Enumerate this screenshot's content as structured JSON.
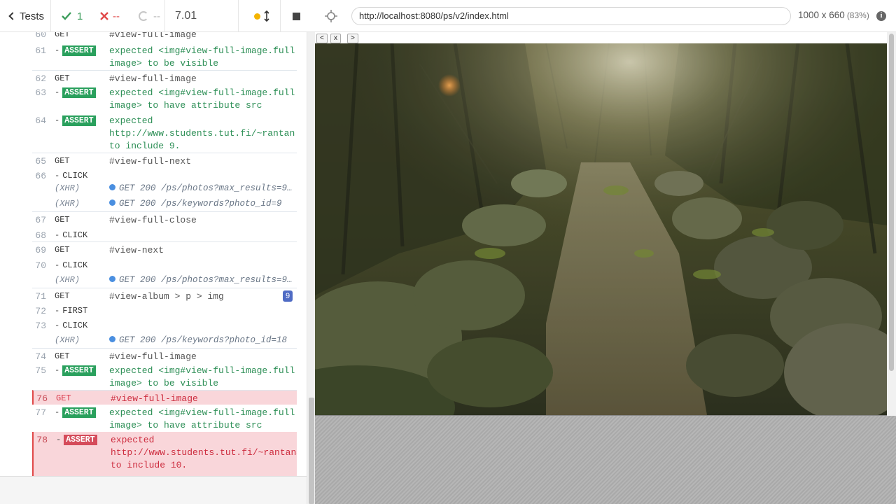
{
  "header": {
    "tests_label": "Tests",
    "passed": "1",
    "failed": "--",
    "pending": "--",
    "duration": "7.01"
  },
  "commands": [
    {
      "num": "60",
      "method": "GET",
      "msg": "#view-full-image",
      "kind": "plain"
    },
    {
      "num": "61",
      "method": "ASSERT",
      "lines": [
        "expected <img#view-full-image.full-",
        "image> to be visible"
      ],
      "kind": "assert"
    },
    {
      "num": "62",
      "method": "GET",
      "msg": "#view-full-image",
      "kind": "plain"
    },
    {
      "num": "63",
      "method": "ASSERT",
      "lines": [
        "expected <img#view-full-image.full-",
        "image> to have attribute src"
      ],
      "kind": "assert"
    },
    {
      "num": "64",
      "method": "ASSERT",
      "lines": [
        "expected",
        " http://www.students.tut.fi/~rantan4...",
        " to include 9."
      ],
      "kind": "assert"
    },
    {
      "num": "65",
      "method": "GET",
      "msg": "#view-full-next",
      "kind": "plain"
    },
    {
      "num": "66",
      "method": "CLICK",
      "kind": "child"
    },
    {
      "num": "",
      "method": "(XHR)",
      "msg": "GET 200 /ps/photos?max_results=9&...",
      "kind": "xhr"
    },
    {
      "num": "",
      "method": "(XHR)",
      "msg": "GET 200 /ps/keywords?photo_id=9",
      "kind": "xhr"
    },
    {
      "num": "67",
      "method": "GET",
      "msg": "#view-full-close",
      "kind": "plain"
    },
    {
      "num": "68",
      "method": "CLICK",
      "kind": "child"
    },
    {
      "num": "69",
      "method": "GET",
      "msg": "#view-next",
      "kind": "plain"
    },
    {
      "num": "70",
      "method": "CLICK",
      "kind": "child"
    },
    {
      "num": "",
      "method": "(XHR)",
      "msg": "GET 200 /ps/photos?max_results=9&...",
      "kind": "xhr"
    },
    {
      "num": "71",
      "method": "GET",
      "msg": "#view-album > p > img",
      "badge": "9",
      "kind": "plain"
    },
    {
      "num": "72",
      "method": "FIRST",
      "kind": "child"
    },
    {
      "num": "73",
      "method": "CLICK",
      "kind": "child"
    },
    {
      "num": "",
      "method": "(XHR)",
      "msg": "GET 200 /ps/keywords?photo_id=18",
      "kind": "xhr"
    },
    {
      "num": "74",
      "method": "GET",
      "msg": "#view-full-image",
      "kind": "plain"
    },
    {
      "num": "75",
      "method": "ASSERT",
      "lines": [
        "expected <img#view-full-image.full-",
        "image> to be visible"
      ],
      "kind": "assert"
    },
    {
      "num": "76",
      "method": "GET",
      "msg": "#view-full-image",
      "kind": "error"
    },
    {
      "num": "77",
      "method": "ASSERT",
      "lines": [
        "expected <img#view-full-image.full-",
        "image> to have attribute src"
      ],
      "kind": "assert"
    },
    {
      "num": "78",
      "method": "ASSERT",
      "lines": [
        "expected",
        " http://www.students.tut.fi/~rantan4...",
        " to include 10."
      ],
      "kind": "assert-error"
    }
  ],
  "aut": {
    "url": "http://localhost:8080/ps/v2/index.html",
    "viewport_size": "1000 x 660",
    "zoom": "(83%)",
    "info_glyph": "i"
  },
  "app": {
    "prev_label": "<",
    "close_label": "x",
    "next_label": ">"
  },
  "colors": {
    "pass": "#3a9c5a",
    "fail": "#e04848",
    "assert_badge": "#2aa05d",
    "error_row": "#f9d6da",
    "xhr_dot": "#4a8fe0",
    "count_badge": "#4f6bc4"
  },
  "icons": {
    "back": "chevron-left-icon",
    "pass": "check-icon",
    "fail": "cross-icon",
    "pending": "spinner-icon",
    "autoscroll": "dot-icon",
    "scroll": "arrows-updown-icon",
    "stop": "stop-icon",
    "selector": "crosshair-icon",
    "info": "info-icon"
  }
}
